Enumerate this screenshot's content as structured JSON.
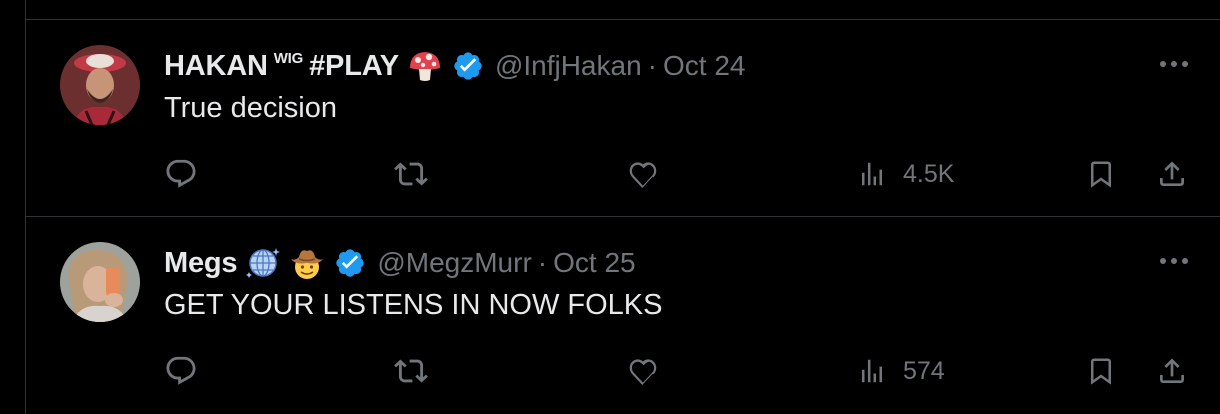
{
  "colors": {
    "background": "#000000",
    "text_primary": "#e7e9ea",
    "text_secondary": "#71767b",
    "divider": "#2f3336",
    "verified_blue": "#1d9bf0"
  },
  "tweets": [
    {
      "display_name": "HAKAN",
      "name_superscript": "WIG",
      "name_suffix": "#PLAY",
      "name_emoji": "mushroom-icon",
      "verified": true,
      "handle": "@InfjHakan",
      "separator": "·",
      "date": "Oct 24",
      "text": "True decision",
      "views": "4.5K"
    },
    {
      "display_name": "Megs",
      "name_emoji": [
        "globe-sparkle-icon",
        "cowboy-face-icon"
      ],
      "verified": true,
      "handle": "@MegzMurr",
      "separator": "·",
      "date": "Oct 25",
      "text": "GET YOUR LISTENS IN NOW FOLKS",
      "views": "574"
    }
  ],
  "icons": {
    "reply": "reply-icon",
    "retweet": "retweet-icon",
    "like": "heart-icon",
    "views": "views-icon",
    "bookmark": "bookmark-icon",
    "share": "share-icon",
    "more": "more-icon"
  }
}
